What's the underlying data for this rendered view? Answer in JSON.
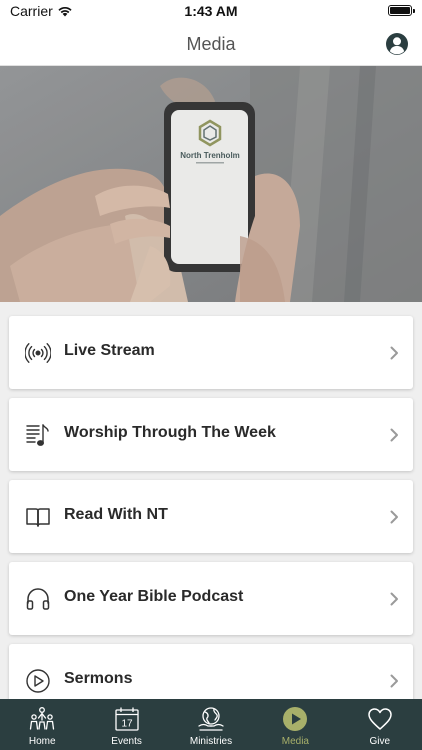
{
  "status_bar": {
    "carrier": "Carrier",
    "time": "1:43 AM"
  },
  "header": {
    "title": "Media"
  },
  "hero": {
    "app_name": "North Trenholm"
  },
  "menu": {
    "items": [
      {
        "label": "Live Stream",
        "icon": "broadcast-icon"
      },
      {
        "label": "Worship Through The Week",
        "icon": "playlist-music-icon"
      },
      {
        "label": "Read With NT",
        "icon": "open-book-icon"
      },
      {
        "label": "One Year Bible Podcast",
        "icon": "headphones-icon"
      },
      {
        "label": "Sermons",
        "icon": "play-circle-icon"
      }
    ]
  },
  "tab_bar": {
    "tabs": [
      {
        "label": "Home",
        "icon": "people-icon"
      },
      {
        "label": "Events",
        "icon": "calendar-icon",
        "calendar_day": "17"
      },
      {
        "label": "Ministries",
        "icon": "globe-hands-icon"
      },
      {
        "label": "Media",
        "icon": "play-icon",
        "active": true
      },
      {
        "label": "Give",
        "icon": "heart-icon"
      }
    ],
    "active_color": "#a8b06a",
    "background": "#2b3e40"
  }
}
